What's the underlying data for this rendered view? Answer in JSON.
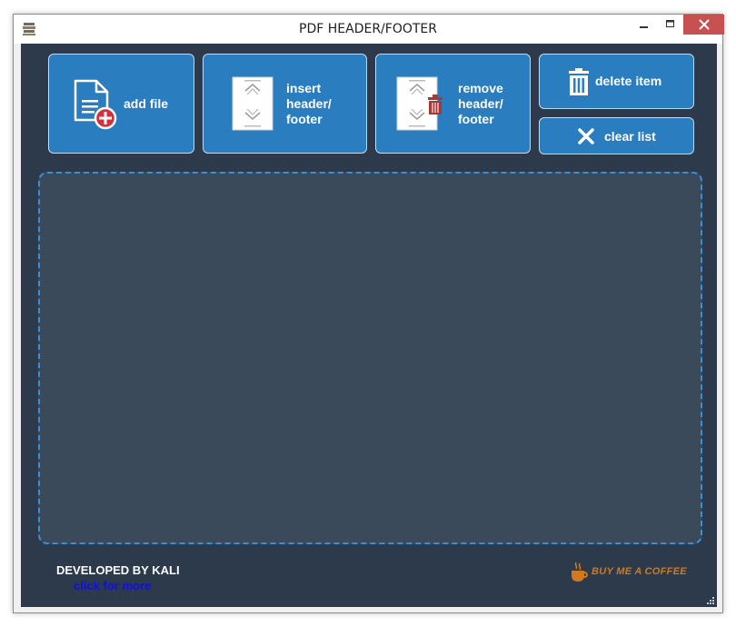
{
  "window": {
    "title": "PDF HEADER/FOOTER"
  },
  "toolbar": {
    "add_file": "add file",
    "insert": [
      "insert",
      "header/",
      "footer"
    ],
    "remove": [
      "remove",
      "header/",
      "footer"
    ],
    "delete_item": "delete item",
    "clear_list": "clear list"
  },
  "footer": {
    "developer": "DEVELOPED BY KALI",
    "link": "click for more",
    "coffee": "BUY ME A COFFEE"
  },
  "colors": {
    "tile": "#2a7dbf",
    "background": "#2c3a4c",
    "dropzone": "#3b4a5b",
    "dropzone_border": "#3a8fd6",
    "close": "#c75050",
    "link": "#1010e0",
    "coffee": "#d07a1e"
  },
  "icons": [
    "app-icon",
    "minimize-icon",
    "maximize-icon",
    "close-icon",
    "add-file-icon",
    "pdf-page-icon",
    "trash-icon",
    "clear-x-icon",
    "coffee-cup-icon",
    "resize-grip-icon"
  ]
}
